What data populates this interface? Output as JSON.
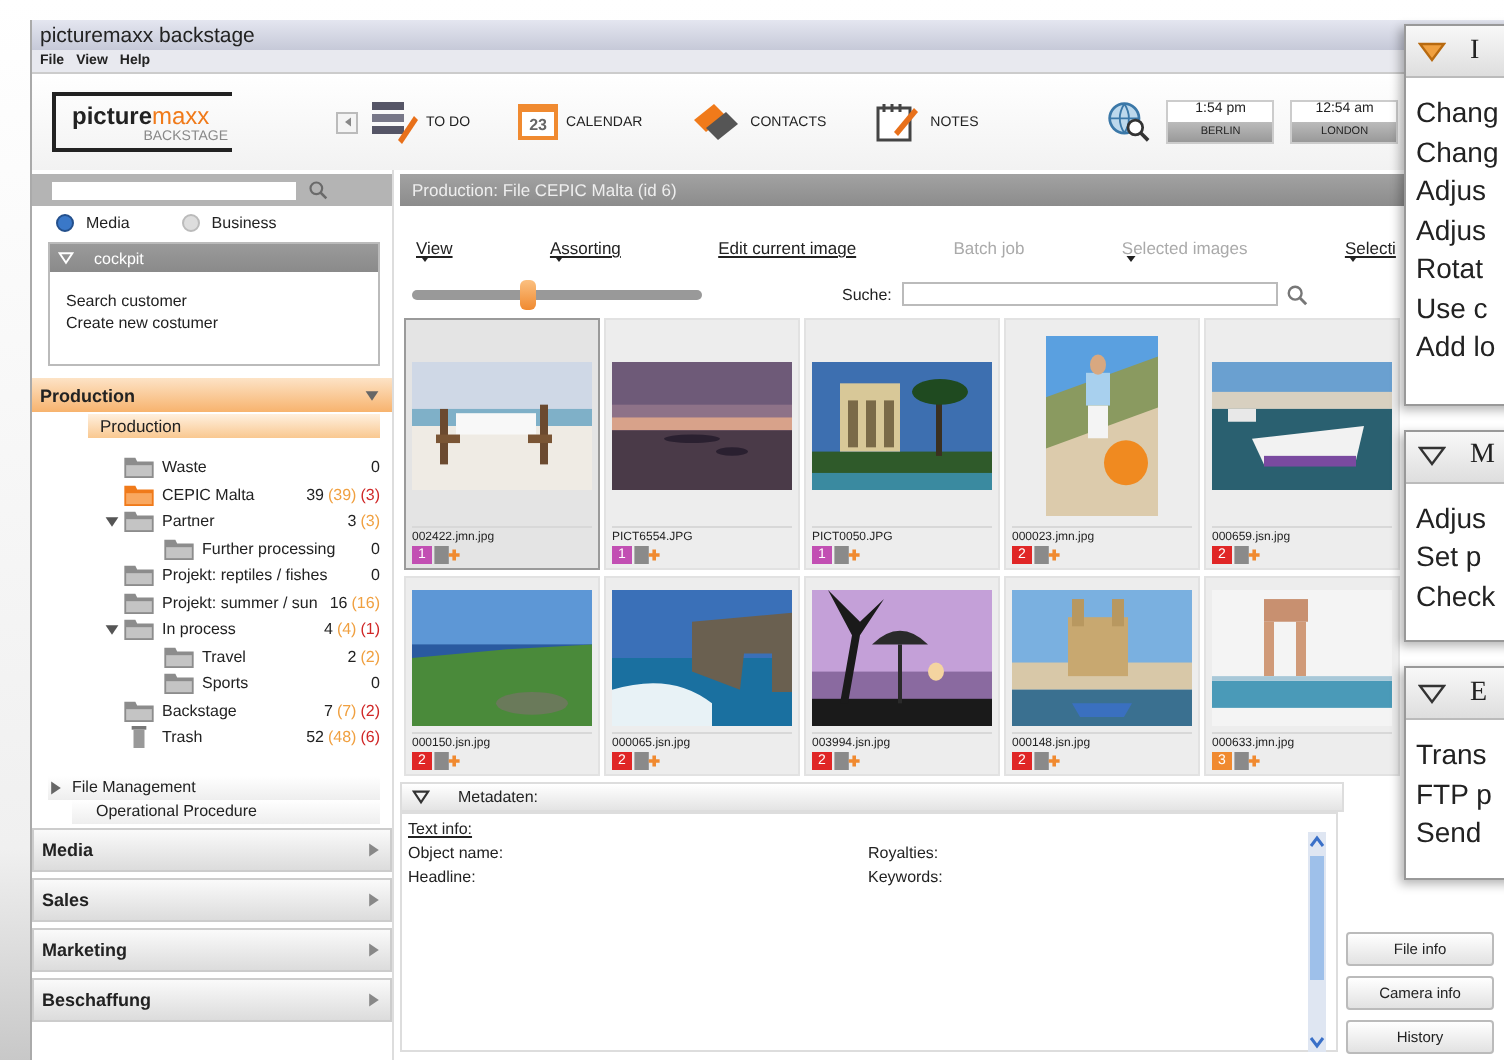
{
  "window": {
    "title": "picturemaxx backstage"
  },
  "menu": [
    "File",
    "View",
    "Help"
  ],
  "logo": {
    "text": "picture",
    "accent": "maxx",
    "subtitle": "BACKSTAGE"
  },
  "toolbar": [
    {
      "kind": "todo",
      "label": "TO DO"
    },
    {
      "kind": "calendar",
      "label": "CALENDAR",
      "icon_text": "23"
    },
    {
      "kind": "contacts",
      "label": "CONTACTS"
    },
    {
      "kind": "notes",
      "label": "NOTES"
    }
  ],
  "clocks": [
    {
      "time": "1:54 pm",
      "city": "BERLIN"
    },
    {
      "time": "12:54 am",
      "city": "LONDON"
    }
  ],
  "sidebar": {
    "scope": [
      {
        "label": "Media",
        "selected": true
      },
      {
        "label": "Business",
        "selected": false
      }
    ],
    "cockpit": {
      "title": "cockpit",
      "expanded": true,
      "links": [
        "Search customer",
        "Create new costumer"
      ]
    },
    "production": {
      "title": "Production",
      "expanded": true,
      "subtitle": "Production",
      "tree": [
        {
          "label": "Waste",
          "kind": "folder",
          "selected": false,
          "count": "0"
        },
        {
          "label": "CEPIC Malta",
          "kind": "folder",
          "selected": true,
          "count": "39",
          "sub_count": "(39)",
          "extra_count": "(3)"
        },
        {
          "label": "Partner",
          "kind": "folder",
          "selected": false,
          "count": "3",
          "sub_count": "(3)",
          "expanded": true,
          "children": [
            {
              "label": "Further processing",
              "kind": "folder",
              "selected": false,
              "count": "0"
            }
          ]
        },
        {
          "label": "Projekt: reptiles / fishes",
          "kind": "folder",
          "selected": false,
          "count": "0"
        },
        {
          "label": "Projekt: summer / sun",
          "kind": "folder",
          "selected": false,
          "count": "16",
          "sub_count": "(16)"
        },
        {
          "label": "In process",
          "kind": "folder",
          "selected": false,
          "count": "4",
          "sub_count": "(4)",
          "extra_count": "(1)",
          "expanded": true,
          "children": [
            {
              "label": "Travel",
              "kind": "folder",
              "selected": false,
              "count": "2",
              "sub_count": "(2)"
            },
            {
              "label": "Sports",
              "kind": "folder",
              "selected": false,
              "count": "0"
            }
          ]
        },
        {
          "label": "Backstage",
          "kind": "folder",
          "selected": false,
          "count": "7",
          "sub_count": "(7)",
          "extra_count": "(2)"
        },
        {
          "label": "Trash",
          "kind": "trash",
          "selected": false,
          "count": "52",
          "sub_count": "(48)",
          "extra_count": "(6)"
        }
      ],
      "links": [
        {
          "label": "File Management",
          "expanded": false
        },
        {
          "label": "Operational Procedure"
        }
      ]
    },
    "sections": [
      {
        "label": "Media",
        "expanded": false
      },
      {
        "label": "Sales",
        "expanded": false
      },
      {
        "label": "Marketing",
        "expanded": false
      },
      {
        "label": "Beschaffung",
        "expanded": false
      }
    ]
  },
  "main": {
    "header": "Production: File CEPIC Malta (id 6)",
    "menu": [
      {
        "label": "View",
        "disabled": false,
        "has_menu": true
      },
      {
        "label": "Assorting",
        "disabled": false,
        "has_menu": true
      },
      {
        "label": "Edit current image",
        "disabled": false,
        "has_menu": false
      },
      {
        "label": "Batch job",
        "disabled": true,
        "has_menu": false
      },
      {
        "label": "Selected images",
        "disabled": true,
        "has_menu": true
      },
      {
        "label": "Selecti",
        "disabled": false,
        "has_menu": true
      }
    ],
    "zoom": {
      "level": 0.4
    },
    "search": {
      "label": "Suche:"
    },
    "thumbnails": [
      {
        "file": "002422.jmn.jpg",
        "selected": true,
        "badge": "1",
        "color": "#c24fb3"
      },
      {
        "file": "PICT6554.JPG",
        "selected": false,
        "badge": "1",
        "color": "#c24fb3"
      },
      {
        "file": "PICT0050.JPG",
        "selected": false,
        "badge": "1",
        "color": "#c24fb3"
      },
      {
        "file": "000023.jmn.jpg",
        "selected": false,
        "badge": "2",
        "color": "#e02626"
      },
      {
        "file": "000659.jsn.jpg",
        "selected": false,
        "badge": "2",
        "color": "#e02626"
      },
      {
        "file": "000150.jsn.jpg",
        "selected": false,
        "badge": "2",
        "color": "#e02626"
      },
      {
        "file": "000065.jsn.jpg",
        "selected": false,
        "badge": "2",
        "color": "#e02626"
      },
      {
        "file": "003994.jsn.jpg",
        "selected": false,
        "badge": "2",
        "color": "#e02626"
      },
      {
        "file": "000148.jsn.jpg",
        "selected": false,
        "badge": "2",
        "color": "#e02626"
      },
      {
        "file": "000633.jmn.jpg",
        "selected": false,
        "badge": "3",
        "color": "#f08a30"
      }
    ]
  },
  "metadata": {
    "title": "Metadaten:",
    "expanded": true,
    "heading": "Text info:",
    "fields_left": [
      "Object name:",
      "Headline:"
    ],
    "fields_right": [
      "Royalties:",
      "Keywords:"
    ],
    "buttons": [
      "File info",
      "Camera info",
      "History"
    ]
  },
  "panel": {
    "sections": [
      {
        "title": "I",
        "selected": true,
        "items": [
          "Chang",
          "Chang",
          "Adjus",
          "Adjus",
          "Rotat",
          "Use c",
          "Add lo"
        ]
      },
      {
        "title": "M",
        "selected": false,
        "items": [
          "Adjus",
          "Set p",
          "Check"
        ]
      },
      {
        "title": "E",
        "selected": false,
        "items": [
          "Trans",
          "FTP p",
          "Send"
        ]
      }
    ]
  }
}
